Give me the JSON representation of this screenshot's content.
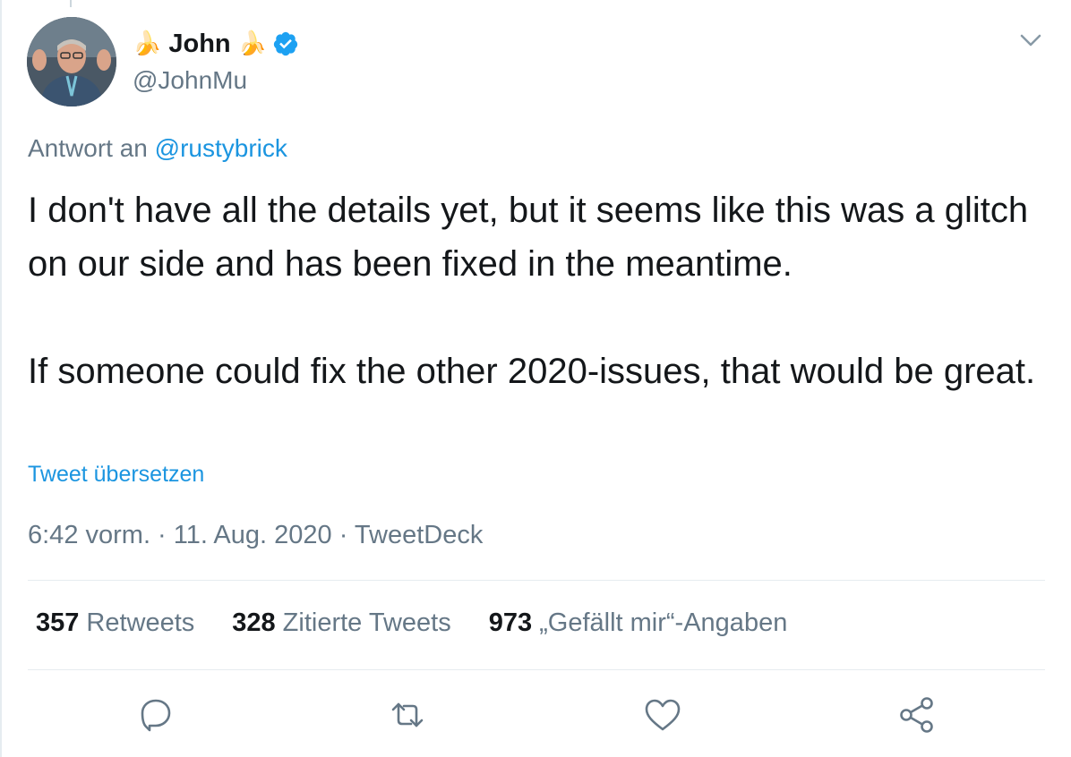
{
  "author": {
    "name_prefix_emoji": "🍌",
    "name": "John",
    "name_suffix_emoji": "🍌",
    "handle": "@JohnMu",
    "verified": true
  },
  "reply": {
    "prefix": "Antwort an",
    "mention": "@rustybrick"
  },
  "tweet": {
    "paragraph_1": "I don't have all the details yet, but it seems like this was a glitch on our side and has been fixed in the meantime.",
    "paragraph_2": "If someone could fix the other 2020-issues, that would be great."
  },
  "translate_label": "Tweet übersetzen",
  "meta": {
    "time": "6:42 vorm.",
    "separator_1": " · ",
    "date": "11. Aug. 2020",
    "separator_2": " · ",
    "source": "TweetDeck"
  },
  "stats": {
    "retweets_count": "357",
    "retweets_label": "Retweets",
    "quotes_count": "328",
    "quotes_label": "Zitierte Tweets",
    "likes_count": "973",
    "likes_label": "„Gefällt mir“-Angaben"
  },
  "icons": {
    "reply": "reply-icon",
    "retweet": "retweet-icon",
    "like": "heart-icon",
    "share": "share-icon",
    "menu": "chevron-down-icon",
    "verified": "verified-badge-icon"
  },
  "colors": {
    "accent": "#1b95e0",
    "verified": "#1da1f2",
    "secondary_text": "#657786",
    "divider": "#e6ecf0"
  }
}
